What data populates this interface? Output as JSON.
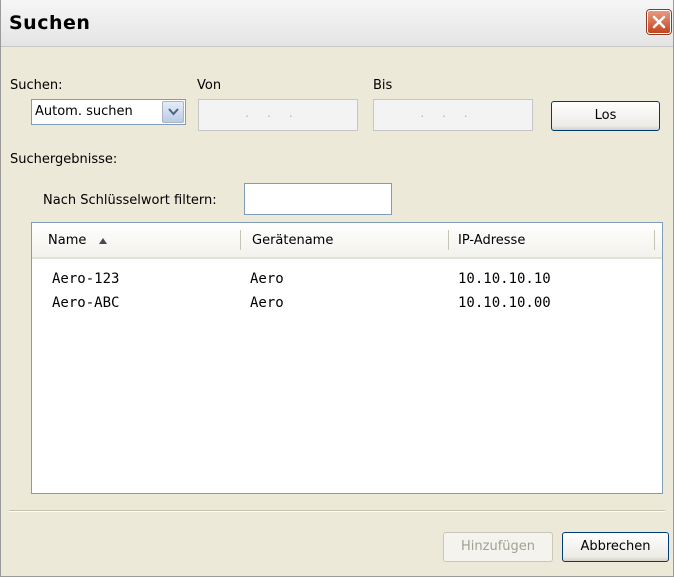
{
  "window": {
    "title": "Suchen"
  },
  "search": {
    "mode_label": "Suchen:",
    "mode_value": "Autom. suchen",
    "from_label": "Von",
    "to_label": "Bis",
    "go_label": "Los"
  },
  "results": {
    "label": "Suchergebnisse:",
    "filter_label": "Nach Schlüsselwort filtern:",
    "filter_value": "",
    "columns": [
      "Name",
      "Gerätename",
      "IP-Adresse"
    ],
    "rows": [
      [
        "Aero-123",
        "Aero",
        "10.10.10.10"
      ],
      [
        "Aero-ABC",
        "Aero",
        "10.10.10.00"
      ]
    ]
  },
  "footer": {
    "add_label": "Hinzufügen",
    "cancel_label": "Abbrechen"
  },
  "icons": {
    "close": "close-icon",
    "dropdown": "chevron-down-icon",
    "sort": "sort-ascending-icon"
  },
  "colors": {
    "close_button": "#c4441f",
    "input_border": "#7f9db9",
    "button_border": "#003c74",
    "dialog_background": "#ece9d8"
  }
}
